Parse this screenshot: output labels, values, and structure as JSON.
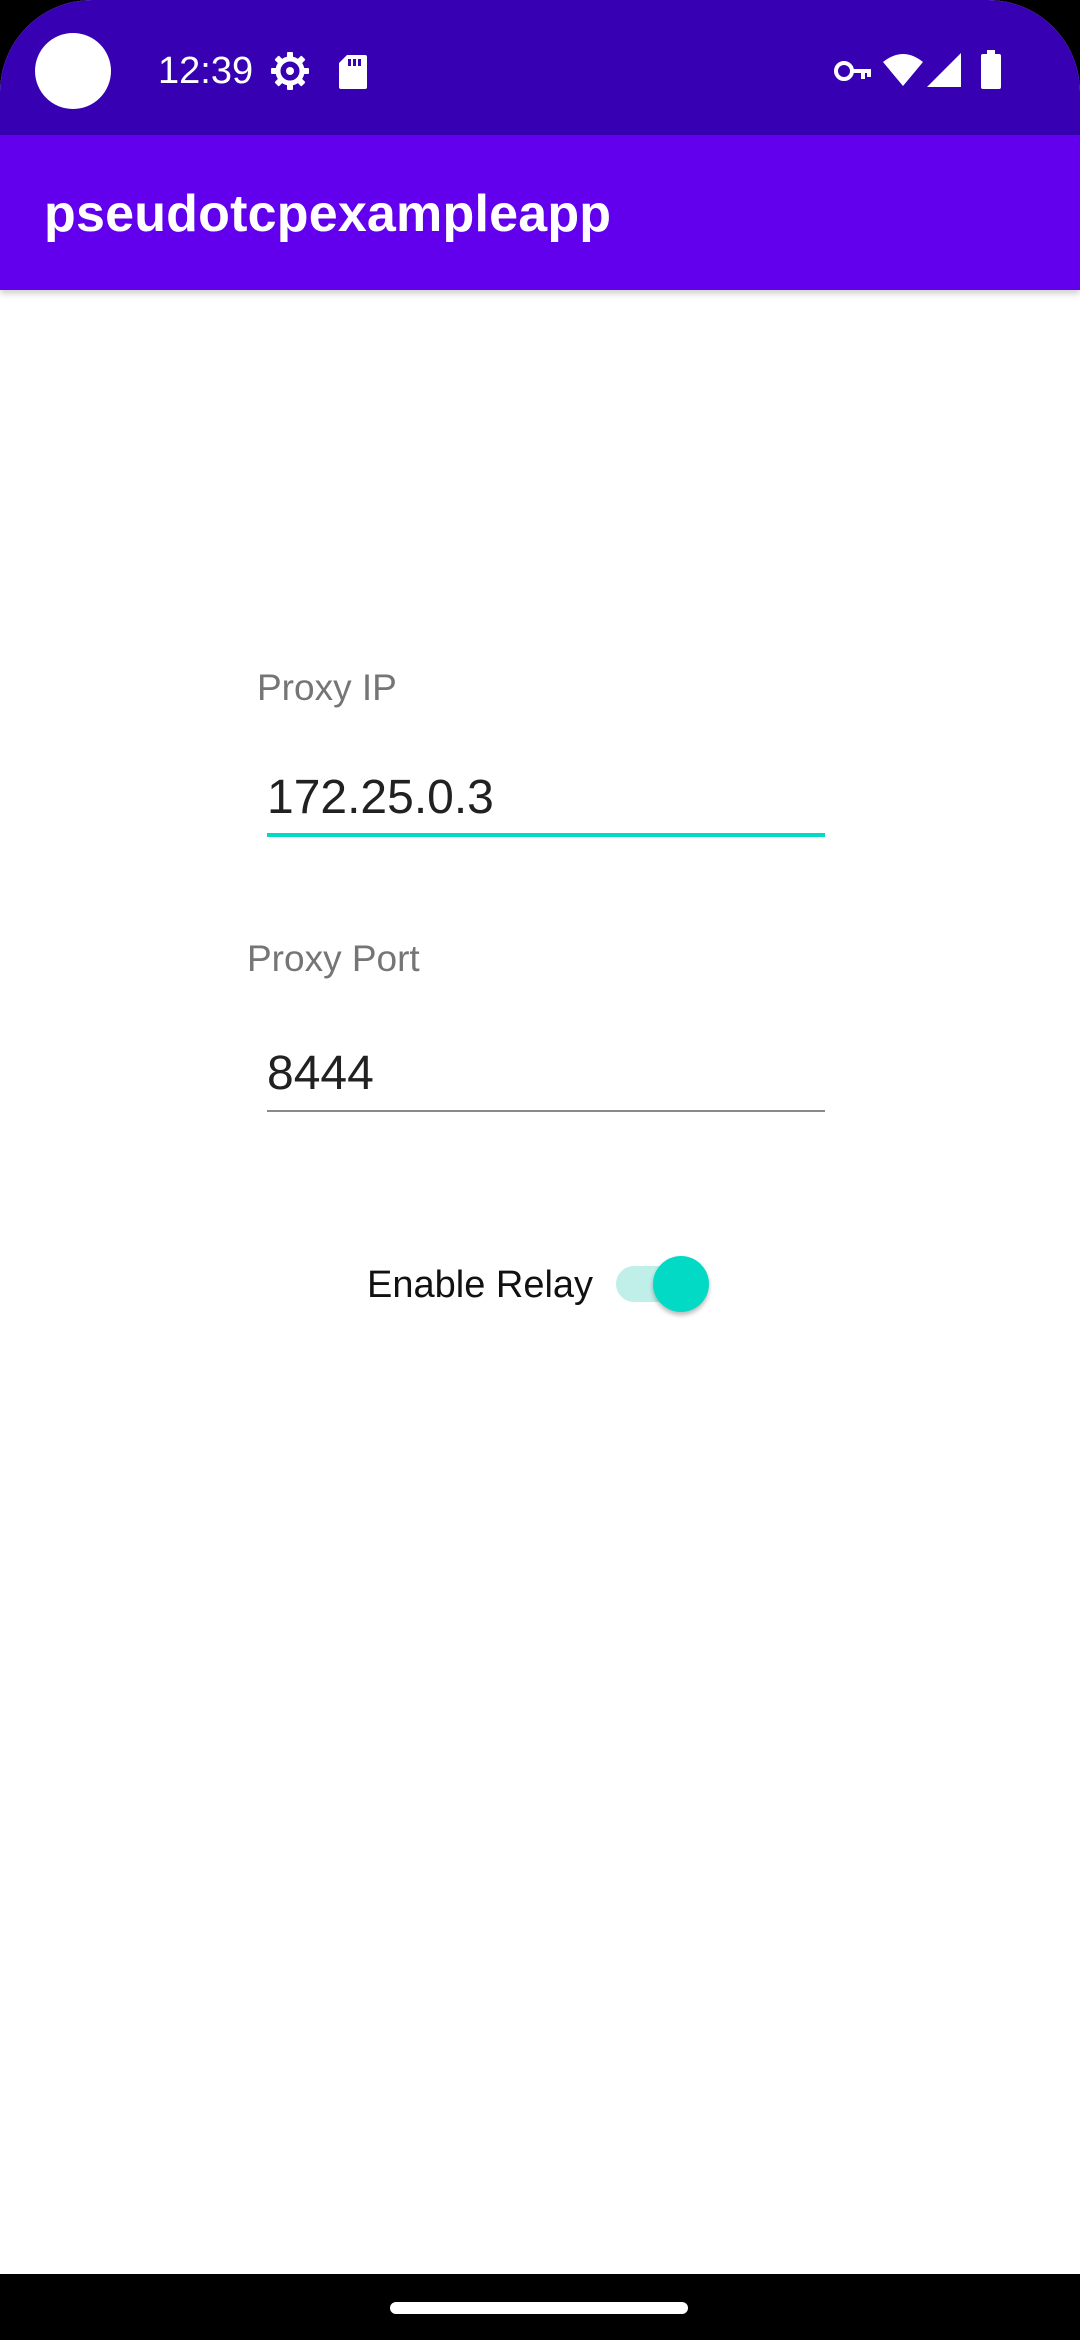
{
  "status_bar": {
    "time": "12:39",
    "left_icons": [
      "settings-gear-icon",
      "sd-card-icon"
    ],
    "right_icons": [
      "vpn-key-icon",
      "wifi-icon",
      "cell-signal-icon",
      "battery-icon"
    ]
  },
  "app_bar": {
    "title": "pseudotcpexampleapp"
  },
  "form": {
    "proxy_ip": {
      "label": "Proxy IP",
      "value": "172.25.0.3",
      "focused": true
    },
    "proxy_port": {
      "label": "Proxy Port",
      "value": "8444"
    },
    "relay": {
      "label": "Enable Relay",
      "enabled": true
    }
  },
  "colors": {
    "status_bar": "#3700b3",
    "app_bar": "#6200ee",
    "accent": "#03dac5",
    "switch_track": "#c0efea",
    "label_gray": "#757575",
    "text_dark": "#212121"
  }
}
